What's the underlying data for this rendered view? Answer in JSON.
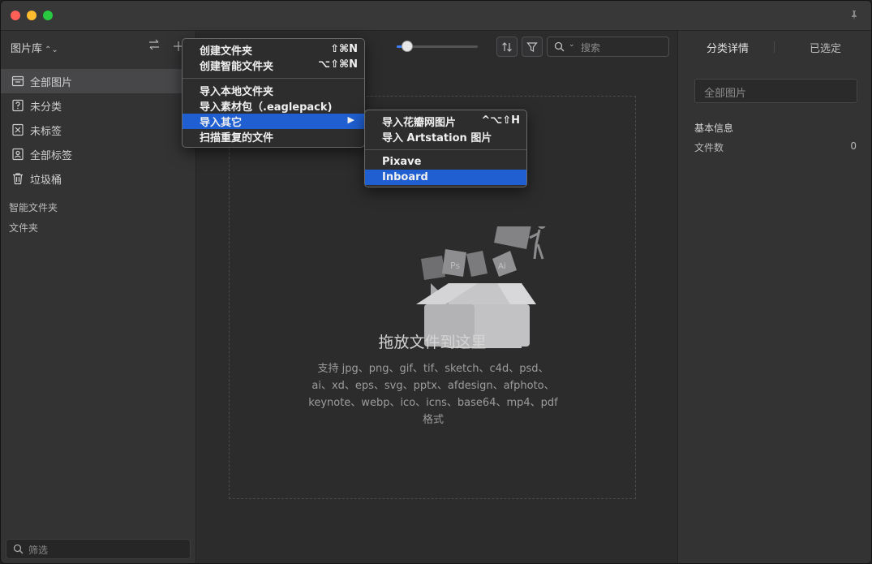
{
  "sidebar": {
    "library_title": "图片库",
    "library_title_arrows": "⌃⌄",
    "nav_items": [
      {
        "label": "全部图片",
        "icon": "inbox-icon",
        "active": true
      },
      {
        "label": "未分类",
        "icon": "question-icon",
        "active": false
      },
      {
        "label": "未标签",
        "icon": "tag-off-icon",
        "active": false
      },
      {
        "label": "全部标签",
        "icon": "tags-icon",
        "active": false
      },
      {
        "label": "垃圾桶",
        "icon": "trash-icon",
        "active": false
      }
    ],
    "smart_folders_label": "智能文件夹",
    "folders_label": "文件夹",
    "filter_placeholder": "筛选"
  },
  "toolbar": {
    "zoom_level": 0.13,
    "search_placeholder": "搜索"
  },
  "dropzone": {
    "title": "拖放文件到这里",
    "subtitle_lines": [
      "支持 jpg、png、gif、tif、sketch、c4d、psd、",
      "ai、xd、eps、svg、pptx、afdesign、afphoto、",
      "keynote、webp、ico、icns、base64、mp4、pdf",
      "格式"
    ]
  },
  "right_panel": {
    "tab_details": "分类详情",
    "tab_selected": "已选定",
    "name_field": "全部图片",
    "info_title": "基本信息",
    "file_count_label": "文件数",
    "file_count_value": "0"
  },
  "context_menu": {
    "items": [
      {
        "label": "创建文件夹",
        "shortcut": "⇧⌘N"
      },
      {
        "label": "创建智能文件夹",
        "shortcut": "⌥⇧⌘N"
      },
      {
        "label": "导入本地文件夹",
        "shortcut": ""
      },
      {
        "label": "导入素材包（.eaglepack)",
        "shortcut": ""
      },
      {
        "label": "导入其它",
        "shortcut": "",
        "submenu": true,
        "highlighted": true
      },
      {
        "label": "扫描重复的文件",
        "shortcut": ""
      }
    ],
    "submenu_arrow": "▶"
  },
  "submenu": {
    "items": [
      {
        "label": "导入花瓣网图片",
        "shortcut": "^⌥⇧H"
      },
      {
        "label": "导入 Artstation 图片",
        "shortcut": ""
      },
      {
        "label": "Pixave",
        "shortcut": ""
      },
      {
        "label": "Inboard",
        "shortcut": "",
        "highlighted": true
      }
    ]
  },
  "colors": {
    "accent": "#3d7ff7",
    "menu_highlight": "#1f5fd1"
  }
}
